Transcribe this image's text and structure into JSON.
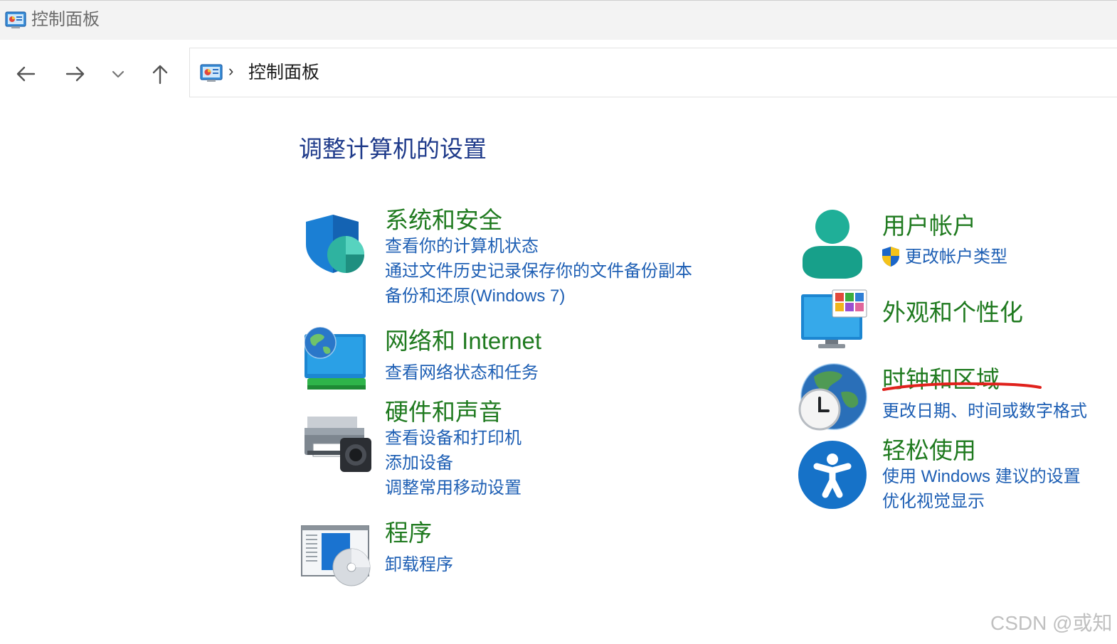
{
  "window": {
    "title": "控制面板",
    "icon": "control-panel-icon"
  },
  "nav": {
    "back_icon": "arrow-left-icon",
    "forward_icon": "arrow-right-icon",
    "recent_icon": "chevron-down-icon",
    "up_icon": "arrow-up-icon"
  },
  "breadcrumb": {
    "separator": "›",
    "current": "控制面板"
  },
  "main": {
    "title": "调整计算机的设置",
    "left_categories": [
      {
        "title": "系统和安全",
        "icon": "shield-icon",
        "links": [
          "查看你的计算机状态",
          "通过文件历史记录保存你的文件备份副本",
          "备份和还原(Windows 7)"
        ]
      },
      {
        "title": "网络和 Internet",
        "icon": "network-globe-icon",
        "links": [
          "查看网络状态和任务"
        ]
      },
      {
        "title": "硬件和声音",
        "icon": "printer-speaker-icon",
        "links": [
          "查看设备和打印机",
          "添加设备",
          "调整常用移动设置"
        ]
      },
      {
        "title": "程序",
        "icon": "programs-disc-icon",
        "links": [
          "卸载程序"
        ]
      }
    ],
    "right_categories": [
      {
        "title": "用户帐户",
        "icon": "user-icon",
        "links": [
          "更改帐户类型"
        ],
        "link_icon": "uac-shield-icon"
      },
      {
        "title": "外观和个性化",
        "icon": "monitor-personalize-icon",
        "links": []
      },
      {
        "title": "时钟和区域",
        "icon": "globe-clock-icon",
        "links": [
          "更改日期、时间或数字格式"
        ],
        "annotation": "red-underline"
      },
      {
        "title": "轻松使用",
        "icon": "accessibility-icon",
        "links": [
          "使用 Windows 建议的设置",
          "优化视觉显示"
        ]
      }
    ]
  },
  "watermark": "CSDN @或知",
  "colors": {
    "category_title": "#1f7a1f",
    "link": "#1e5fb4",
    "page_title": "#1e3a8a",
    "annotation": "#e0211c"
  }
}
